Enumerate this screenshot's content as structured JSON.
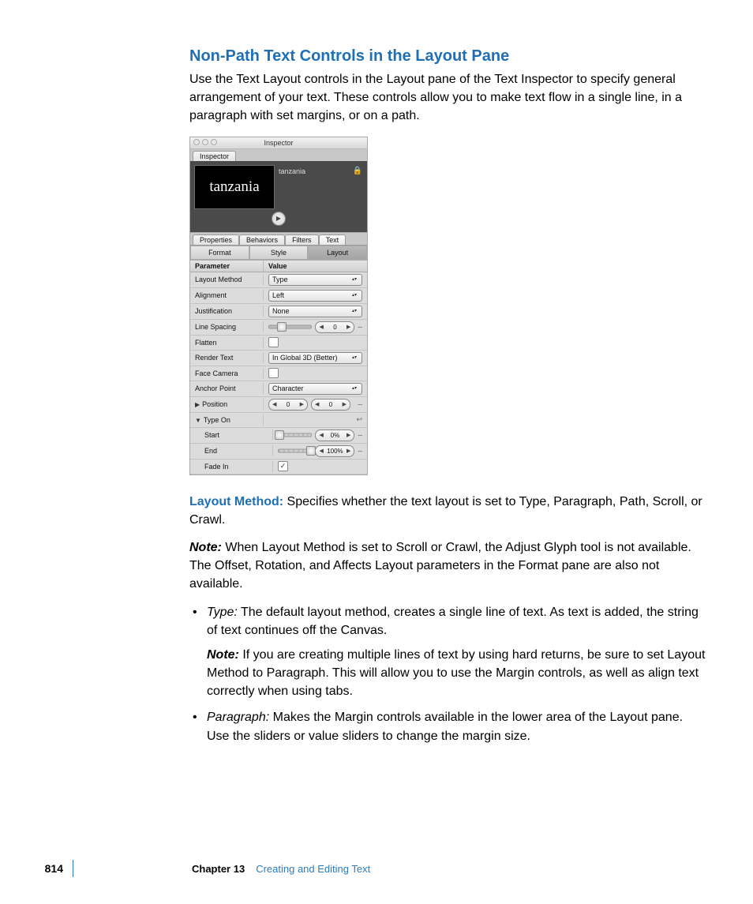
{
  "heading": "Non-Path Text Controls in the Layout Pane",
  "intro": "Use the Text Layout controls in the Layout pane of the Text Inspector to specify general arrangement of your text. These controls allow you to make text flow in a single line, in a paragraph with set margins, or on a path.",
  "inspector": {
    "windowTitle": "Inspector",
    "tabLabel": "Inspector",
    "previewText": "tanzania",
    "previewName": "tanzania",
    "subtabs": [
      "Properties",
      "Behaviors",
      "Filters",
      "Text"
    ],
    "pillTabs": [
      "Format",
      "Style",
      "Layout"
    ],
    "headers": [
      "Parameter",
      "Value"
    ],
    "rows": {
      "layoutMethod": {
        "label": "Layout Method",
        "value": "Type"
      },
      "alignment": {
        "label": "Alignment",
        "value": "Left"
      },
      "justification": {
        "label": "Justification",
        "value": "None"
      },
      "lineSpacing": {
        "label": "Line Spacing",
        "value": "0"
      },
      "flatten": {
        "label": "Flatten"
      },
      "renderText": {
        "label": "Render Text",
        "value": "In Global 3D (Better)"
      },
      "faceCamera": {
        "label": "Face Camera"
      },
      "anchorPoint": {
        "label": "Anchor Point",
        "value": "Character"
      },
      "position": {
        "label": "Position",
        "v1": "0",
        "v2": "0"
      },
      "typeOn": {
        "label": "Type On"
      },
      "start": {
        "label": "Start",
        "value": "0%"
      },
      "end": {
        "label": "End",
        "value": "100%"
      },
      "fadeIn": {
        "label": "Fade In"
      }
    }
  },
  "layoutMethodLabel": "Layout Method:",
  "layoutMethodText": "  Specifies whether the text layout is set to Type, Paragraph, Path, Scroll, or Crawl.",
  "note1Label": "Note:",
  "note1Text": "  When Layout Method is set to Scroll or Crawl, the Adjust Glyph tool is not available. The Offset, Rotation, and Affects Layout parameters in the Format pane are also not available.",
  "typeLabel": "Type:",
  "typeText": "  The default layout method, creates a single line of text. As text is added, the string of text continues off the Canvas.",
  "note2Label": "Note:",
  "note2Text": "  If you are creating multiple lines of text by using hard returns, be sure to set Layout Method to Paragraph. This will allow you to use the Margin controls, as well as align text correctly when using tabs.",
  "paragraphLabel": "Paragraph:",
  "paragraphText": "  Makes the Margin controls available in the lower area of the Layout pane. Use the sliders or value sliders to change the margin size.",
  "footer": {
    "page": "814",
    "chapterLabel": "Chapter 13",
    "chapterTitle": "Creating and Editing Text"
  }
}
